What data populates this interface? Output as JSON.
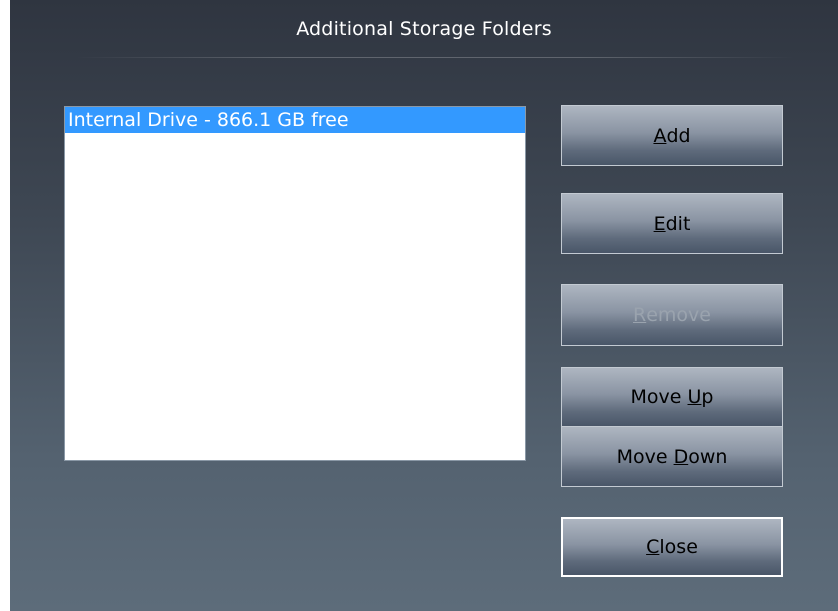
{
  "dialog": {
    "title": "Additional Storage Folders"
  },
  "list": {
    "items": [
      {
        "label": "Internal Drive - 866.1 GB free",
        "selected": true
      }
    ]
  },
  "buttons": {
    "add": {
      "access_key": "A",
      "rest": "dd",
      "enabled": true
    },
    "edit": {
      "access_key": "E",
      "rest": "dit",
      "enabled": true
    },
    "remove": {
      "access_key": "R",
      "rest": "emove",
      "enabled": false
    },
    "move_up": {
      "prefix": "Move ",
      "access_key": "U",
      "rest": "p",
      "enabled": true
    },
    "move_down": {
      "prefix": "Move ",
      "access_key": "D",
      "rest": "own",
      "enabled": true
    },
    "close": {
      "access_key": "C",
      "rest": "lose",
      "enabled": true,
      "is_default": true
    }
  },
  "colors": {
    "selection": "#3399ff",
    "background_top": "#2f3540",
    "background_bottom": "#5d6c7a",
    "disabled_text": "#9aa3ae"
  }
}
